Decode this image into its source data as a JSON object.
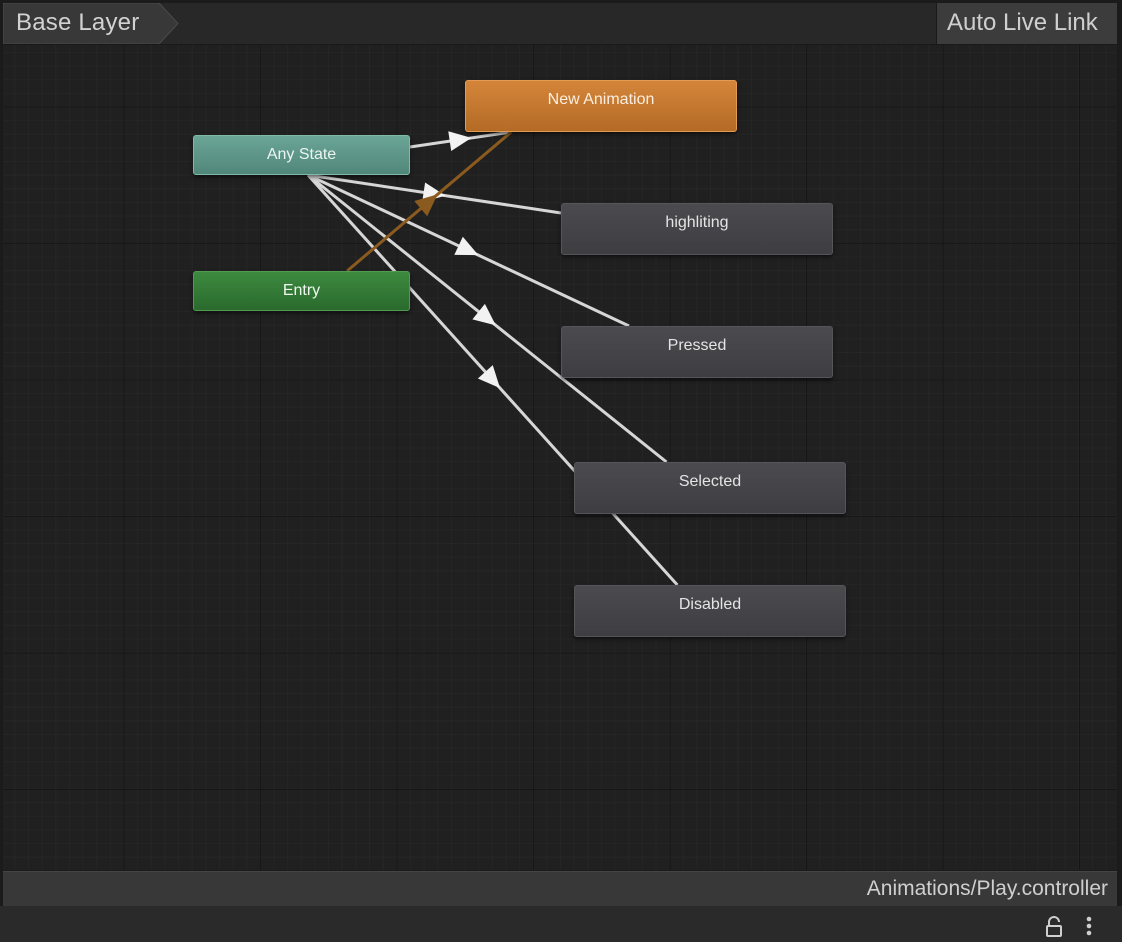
{
  "toolbar": {
    "breadcrumb_label": "Base Layer",
    "auto_live_link_label": "Auto Live Link"
  },
  "graph": {
    "nodes": [
      {
        "id": "new-animation",
        "label": "New Animation",
        "kind": "default"
      },
      {
        "id": "any-state",
        "label": "Any State",
        "kind": "anystate"
      },
      {
        "id": "highliting",
        "label": "highliting",
        "kind": "state"
      },
      {
        "id": "entry",
        "label": "Entry",
        "kind": "entry"
      },
      {
        "id": "pressed",
        "label": "Pressed",
        "kind": "state"
      },
      {
        "id": "selected",
        "label": "Selected",
        "kind": "state"
      },
      {
        "id": "disabled",
        "label": "Disabled",
        "kind": "state"
      }
    ],
    "transitions": [
      {
        "from": "any-state",
        "to": "new-animation",
        "color": "#d6d6d6"
      },
      {
        "from": "any-state",
        "to": "highliting",
        "color": "#d6d6d6"
      },
      {
        "from": "any-state",
        "to": "pressed",
        "color": "#d6d6d6"
      },
      {
        "from": "any-state",
        "to": "selected",
        "color": "#d6d6d6"
      },
      {
        "from": "any-state",
        "to": "disabled",
        "color": "#d6d6d6"
      },
      {
        "from": "entry",
        "to": "new-animation",
        "color": "#8a5a1e"
      }
    ]
  },
  "status_bar": {
    "path": "Animations/Play.controller"
  },
  "footer": {
    "icons": [
      "lock-icon",
      "more-vertical-icon"
    ]
  },
  "colors": {
    "default_state": "#c67a30",
    "any_state": "#5f9889",
    "entry_state": "#337a36",
    "normal_state": "#444448",
    "default_transition": "#8a5a1e",
    "transition": "#d6d6d6"
  }
}
